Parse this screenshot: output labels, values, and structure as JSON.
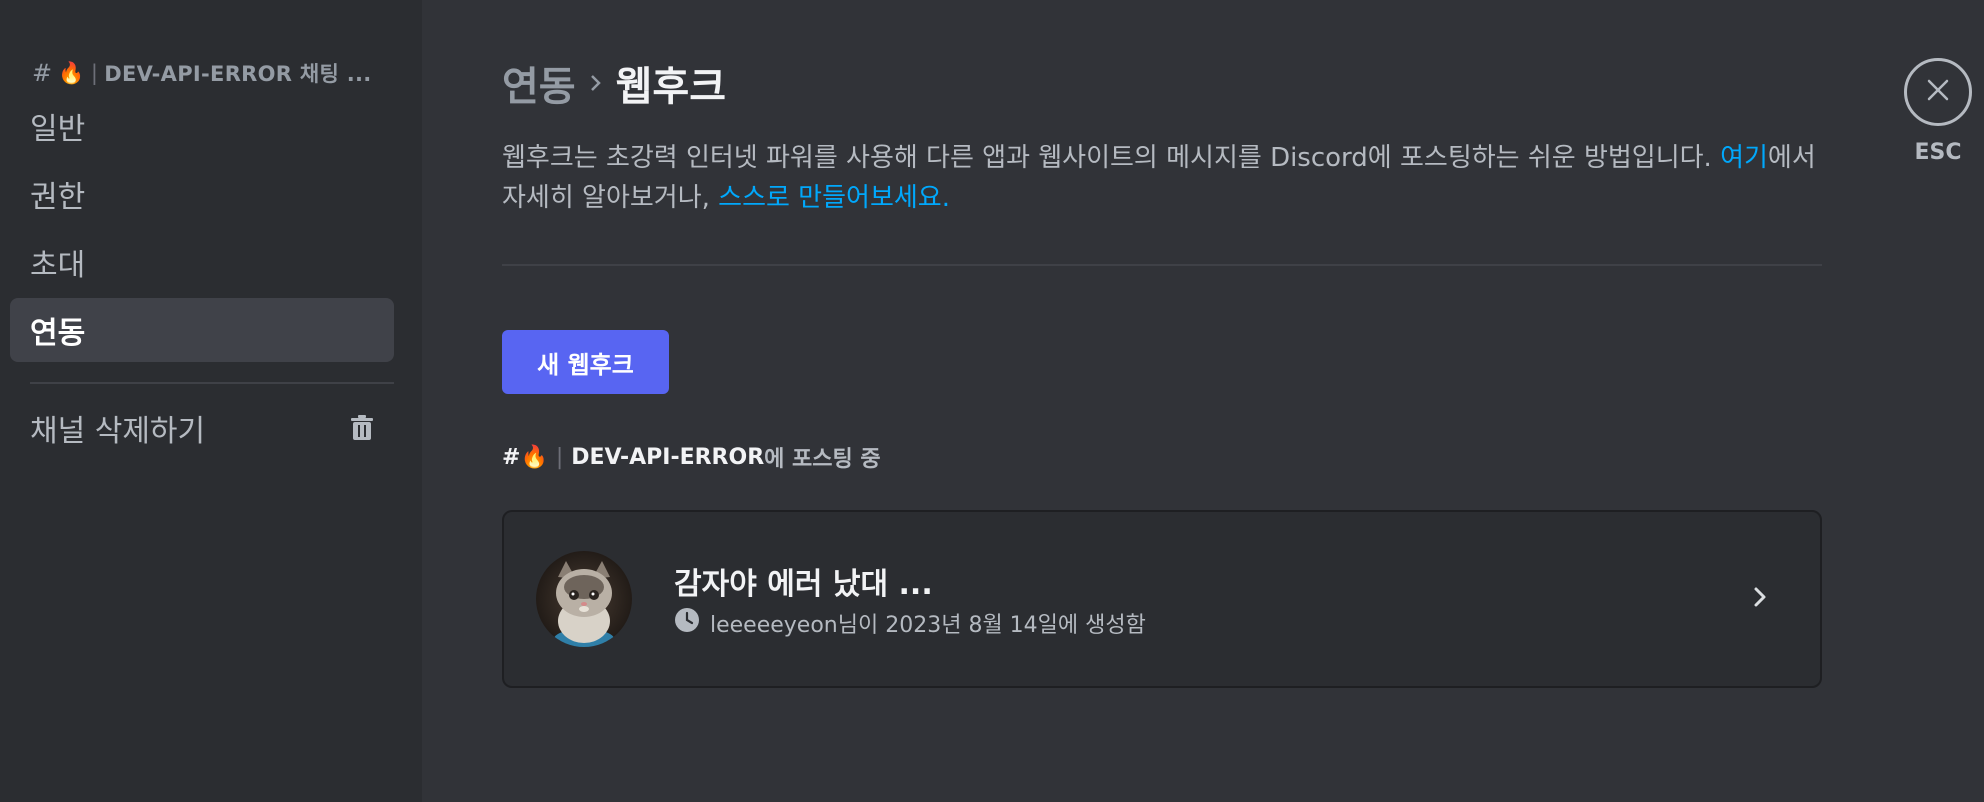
{
  "sidebar": {
    "header": {
      "hash": "#",
      "emoji": "🔥",
      "pipe": "|",
      "channel": "DEV-API-ERROR 채팅 ..."
    },
    "items": [
      {
        "label": "일반"
      },
      {
        "label": "권한"
      },
      {
        "label": "초대"
      },
      {
        "label": "연동"
      }
    ],
    "active_index": 3,
    "delete_label": "채널 삭제하기"
  },
  "main": {
    "breadcrumb": {
      "parent": "연동",
      "current": "웹후크"
    },
    "description": {
      "text1": "웹후크는 초강력 인터넷 파워를 사용해 다른 앱과 웹사이트의 메시지를 Discord에 포스팅하는 쉬운 방법입니다. ",
      "link1": "여기",
      "text2": "에서 자세히 알아보거나, ",
      "link2": "스스로 만들어보세요."
    },
    "new_webhook_label": "새 웹후크",
    "posting": {
      "hash": "#",
      "emoji": "🔥",
      "pipe": "|",
      "channel": "DEV-API-ERROR",
      "suffix": "에 포스팅 중"
    },
    "webhook": {
      "name": "감자야 에러 났대 ...",
      "meta": "leeeeeyeon님이 2023년 8월 14일에 생성함"
    }
  },
  "close": {
    "esc_label": "ESC"
  },
  "colors": {
    "accent": "#5865f2",
    "link": "#00a8fc",
    "background": "#313338",
    "sidebar": "#2b2d31"
  }
}
